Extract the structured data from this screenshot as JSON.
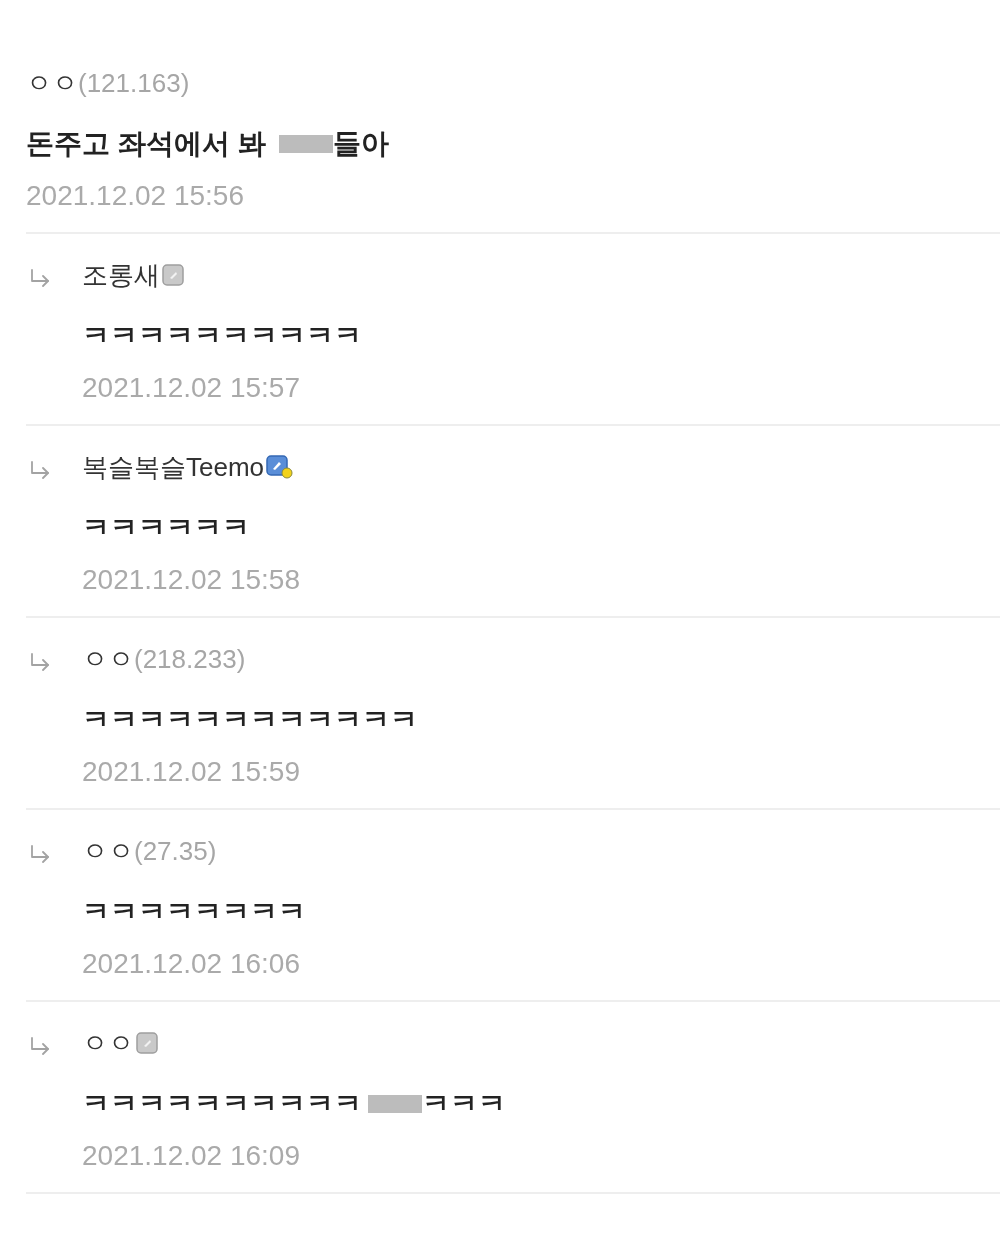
{
  "comment": {
    "author": "ㅇㅇ",
    "ip": "(121.163)",
    "body": [
      {
        "kind": "text",
        "text": "돈주고 좌석에서 봐 "
      },
      {
        "kind": "redaction"
      },
      {
        "kind": "text",
        "text": "들아"
      }
    ],
    "date": "2021.12.02 15:56"
  },
  "replies": [
    {
      "author": "조롱새",
      "badge": {
        "kind": "plain"
      },
      "body": [
        {
          "kind": "text",
          "text": "ㅋㅋㅋㅋㅋㅋㅋㅋㅋㅋ"
        }
      ],
      "date": "2021.12.02 15:57"
    },
    {
      "author": "복슬복슬Teemo",
      "badge": {
        "kind": "dotted"
      },
      "body": [
        {
          "kind": "text",
          "text": "ㅋㅋㅋㅋㅋㅋ"
        }
      ],
      "date": "2021.12.02 15:58"
    },
    {
      "author": "ㅇㅇ",
      "ip": "(218.233)",
      "body": [
        {
          "kind": "text",
          "text": "ㅋㅋㅋㅋㅋㅋㅋㅋㅋㅋㅋㅋ"
        }
      ],
      "date": "2021.12.02 15:59"
    },
    {
      "author": "ㅇㅇ",
      "ip": "(27.35)",
      "body": [
        {
          "kind": "text",
          "text": "ㅋㅋㅋㅋㅋㅋㅋㅋ"
        }
      ],
      "date": "2021.12.02 16:06"
    },
    {
      "author": "ㅇㅇ",
      "badge": {
        "kind": "plain"
      },
      "body": [
        {
          "kind": "text",
          "text": "ㅋㅋㅋㅋㅋㅋㅋㅋㅋㅋ"
        },
        {
          "kind": "redaction"
        },
        {
          "kind": "text",
          "text": "ㅋㅋㅋ"
        }
      ],
      "date": "2021.12.02 16:09"
    }
  ]
}
